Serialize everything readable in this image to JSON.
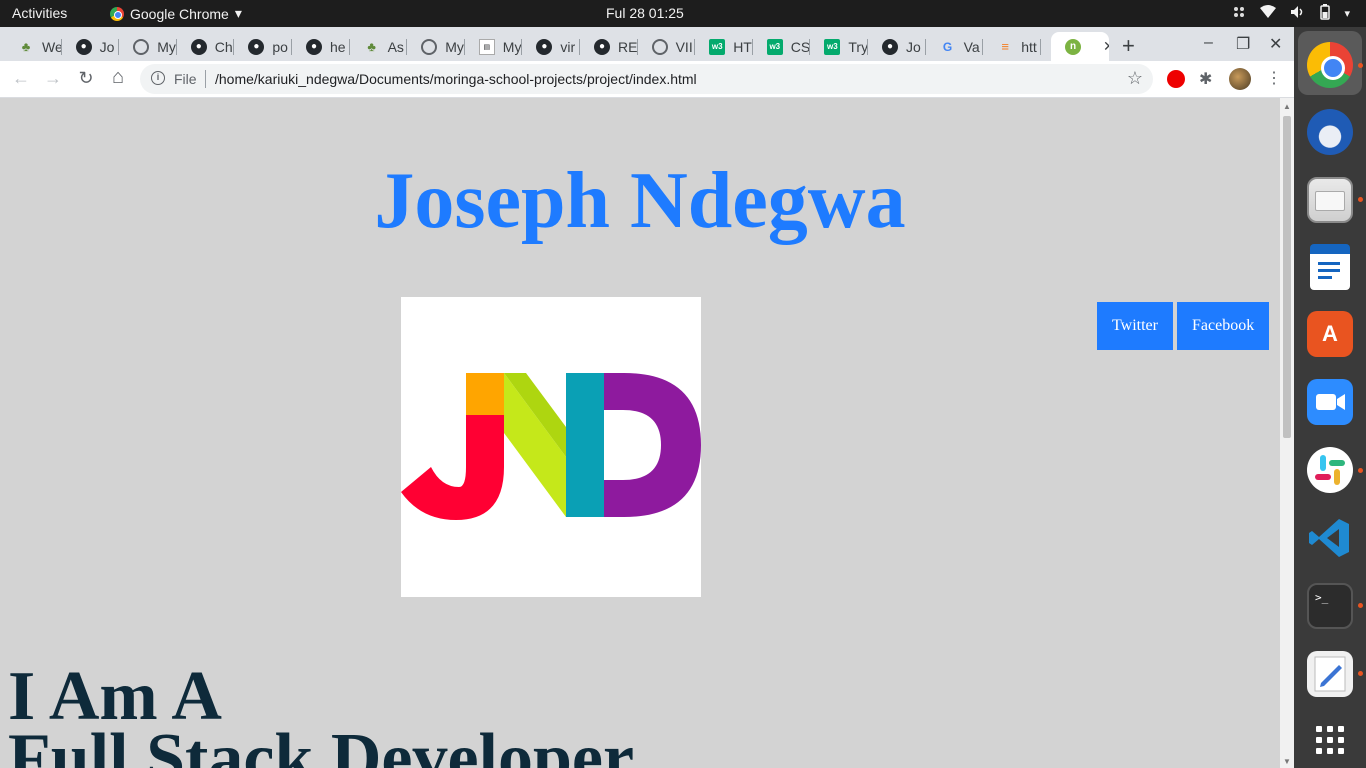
{
  "topbar": {
    "activities": "Activities",
    "app_name": "Google Chrome",
    "app_caret": "▾",
    "clock": "Ful 28  01:25"
  },
  "tabs": [
    {
      "label": "We",
      "icon": "tree-icon"
    },
    {
      "label": "Jo",
      "icon": "github-icon"
    },
    {
      "label": "My",
      "icon": "globe-icon"
    },
    {
      "label": "Ch",
      "icon": "github-icon"
    },
    {
      "label": "po",
      "icon": "github-icon"
    },
    {
      "label": "he",
      "icon": "github-icon"
    },
    {
      "label": "As",
      "icon": "tree-icon"
    },
    {
      "label": "My",
      "icon": "globe-icon"
    },
    {
      "label": "My",
      "icon": "doc-icon"
    },
    {
      "label": "vir",
      "icon": "github-icon"
    },
    {
      "label": "RE",
      "icon": "github-icon"
    },
    {
      "label": "VII",
      "icon": "globe-icon"
    },
    {
      "label": "HT",
      "icon": "w3schools-icon"
    },
    {
      "label": "CS",
      "icon": "w3schools-icon"
    },
    {
      "label": "Try",
      "icon": "w3schools-icon"
    },
    {
      "label": "Jo",
      "icon": "github-icon"
    },
    {
      "label": "Va",
      "icon": "google-icon"
    },
    {
      "label": "htt",
      "icon": "stackoverflow-icon"
    }
  ],
  "active_tab": {
    "label": "",
    "icon": "green-circle-icon",
    "close": "✕"
  },
  "new_tab": "+",
  "window_controls": {
    "minimize": "–",
    "maximize": "❐",
    "close": "✕"
  },
  "toolbar": {
    "back": "←",
    "forward": "→",
    "reload": "↻",
    "home": "⌂",
    "info": "i",
    "file_label": "File",
    "url": "/home/kariuki_ndegwa/Documents/moringa-school-projects/project/index.html",
    "bookmark_star": "☆",
    "extensions_icon": "✱",
    "menu": "⋮"
  },
  "page": {
    "title": "Joseph Ndegwa",
    "social": {
      "twitter": "Twitter",
      "facebook": "Facebook"
    },
    "intro_line1": "I Am A",
    "intro_line2": "Full Stack Developer"
  },
  "colors": {
    "title_blue": "#1e7bff",
    "page_bg": "#d3d3d3",
    "intro_text": "#0e2a3a",
    "logo_red": "#ff0033",
    "logo_orange": "#ffa500",
    "logo_lime": "#c5e81a",
    "logo_teal": "#0aa0b5",
    "logo_purple": "#8e1a9e"
  },
  "dock": [
    {
      "name": "chrome-icon"
    },
    {
      "name": "thunderbird-icon"
    },
    {
      "name": "files-icon"
    },
    {
      "name": "libreoffice-writer-icon"
    },
    {
      "name": "software-store-icon"
    },
    {
      "name": "zoom-icon"
    },
    {
      "name": "slack-icon"
    },
    {
      "name": "vscode-icon"
    },
    {
      "name": "terminal-icon"
    },
    {
      "name": "text-editor-icon"
    },
    {
      "name": "show-apps-icon"
    }
  ]
}
